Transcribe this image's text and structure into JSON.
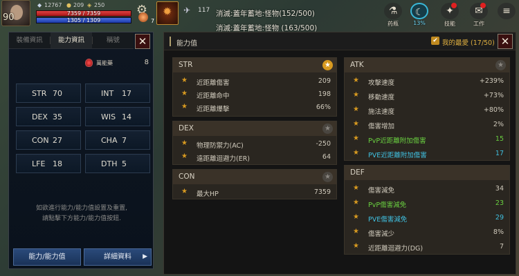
{
  "hud": {
    "level": "90",
    "currency1_value": "12767",
    "currency2_value": "209",
    "currency3_value": "250",
    "hp": {
      "text": "7359 / 7359",
      "fraction": 1.0
    },
    "mp": {
      "text": "1305 / 1309",
      "fraction": 0.997
    },
    "potion_count": "7",
    "feather_count": "117",
    "quest_lines": [
      "消滅:蓋年蓄地:怪物(152/500)",
      "消滅:蓋年蓄地:怪物 (163/500)"
    ],
    "right_buttons": [
      {
        "label": "药瓶",
        "icon": "⚗"
      },
      {
        "label": "13%",
        "icon": "☾"
      },
      {
        "label": "技能",
        "icon": "✦"
      },
      {
        "label": "工作",
        "icon": "✉"
      },
      {
        "label": "",
        "icon": "≡"
      }
    ]
  },
  "left_panel": {
    "tabs": [
      "裝備資訊",
      "能力資訊",
      "稱號"
    ],
    "close_label": "✕",
    "potion_label": "萬能藥",
    "potion_value": "8",
    "stats": [
      {
        "name": "STR",
        "value": "70"
      },
      {
        "name": "INT",
        "value": "17"
      },
      {
        "name": "DEX",
        "value": "35"
      },
      {
        "name": "WIS",
        "value": "14"
      },
      {
        "name": "CON",
        "value": "27"
      },
      {
        "name": "CHA",
        "value": "7"
      },
      {
        "name": "LFE",
        "value": "18"
      },
      {
        "name": "DTH",
        "value": "5"
      }
    ],
    "hint_line1": "如欲進行能力/能力值設置及重置,",
    "hint_line2": "請點擊下方能力/能力值按鈕.",
    "btn_ability": "能力/能力值",
    "btn_detail": "詳細資料",
    "btn_detail_arrow": "▶"
  },
  "right_panel": {
    "title": "能力值",
    "fav_check": "✔",
    "fav_label": "我的最愛 (17/50)",
    "close_label": "✕",
    "sections": {
      "str": {
        "name": "STR",
        "starred": true,
        "rows": [
          {
            "name": "近距離傷害",
            "value": "209"
          },
          {
            "name": "近距離命中",
            "value": "198"
          },
          {
            "name": "近距離爆擊",
            "value": "66%"
          }
        ]
      },
      "dex": {
        "name": "DEX",
        "starred": false,
        "rows": [
          {
            "name": "物理防禦力(AC)",
            "value": "-250"
          },
          {
            "name": "遠距離迴避力(ER)",
            "value": "64"
          }
        ]
      },
      "con": {
        "name": "CON",
        "starred": false,
        "rows": [
          {
            "name": "最大HP",
            "value": "7359"
          }
        ]
      },
      "atk": {
        "name": "ATK",
        "starred": false,
        "rows": [
          {
            "name": "攻擊速度",
            "value": "+239%",
            "kind": ""
          },
          {
            "name": "移動速度",
            "value": "+73%",
            "kind": ""
          },
          {
            "name": "施法速度",
            "value": "+80%",
            "kind": ""
          },
          {
            "name": "傷害增加",
            "value": "2%",
            "kind": ""
          },
          {
            "name": "PvP近距離附加傷害",
            "value": "15",
            "kind": "pvp"
          },
          {
            "name": "PVE近距離附加傷害",
            "value": "17",
            "kind": "pve"
          }
        ]
      },
      "def": {
        "name": "DEF",
        "starred": false,
        "rows": [
          {
            "name": "傷害減免",
            "value": "34",
            "kind": ""
          },
          {
            "name": "PvP傷害減免",
            "value": "23",
            "kind": "pvp"
          },
          {
            "name": "PVE傷害減免",
            "value": "29",
            "kind": "pve"
          },
          {
            "name": "傷害減少",
            "value": "8%",
            "kind": ""
          },
          {
            "name": "近距離迴避力(DG)",
            "value": "7",
            "kind": ""
          }
        ]
      }
    }
  },
  "colors": {
    "accent_gold": "#d89a20",
    "pvp_green": "#6ad040",
    "pve_cyan": "#40c0e0",
    "hp_red": "#c82828",
    "mp_blue": "#2c50c8"
  }
}
